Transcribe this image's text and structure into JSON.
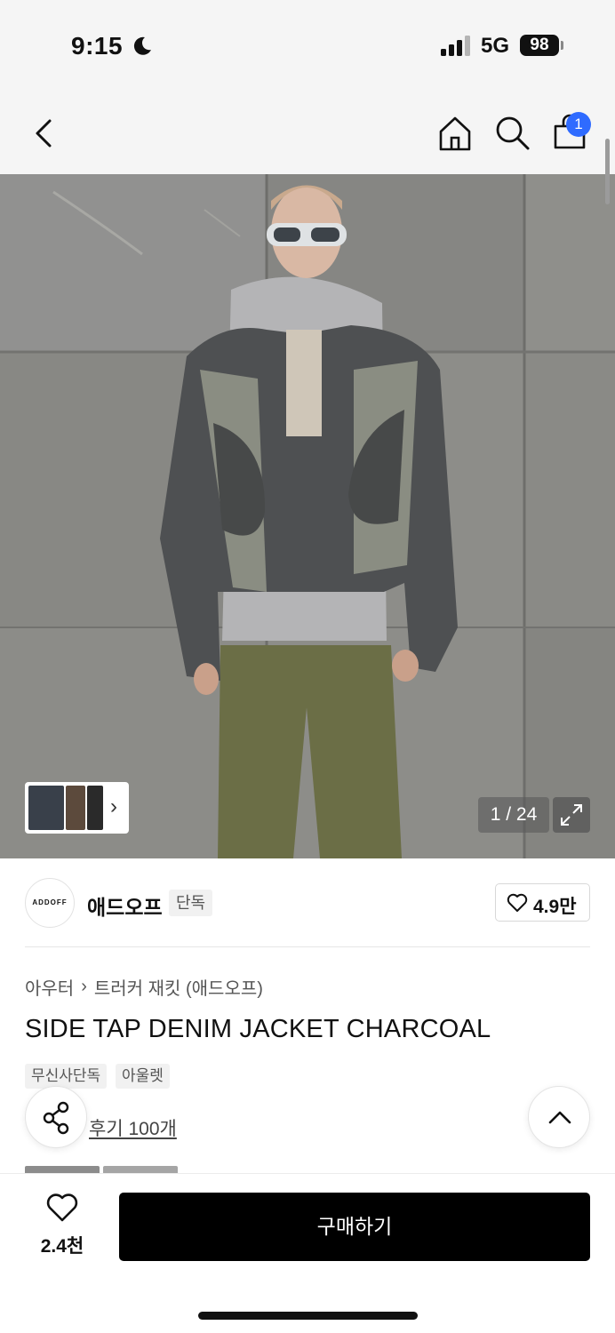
{
  "status_bar": {
    "time": "9:15",
    "network": "5G",
    "battery": "98"
  },
  "nav": {
    "cart_count": "1"
  },
  "gallery": {
    "counter": "1 / 24"
  },
  "brand": {
    "logo_text": "ADDOFF",
    "name": "애드오프",
    "badge": "단독",
    "likes": "4.9만"
  },
  "product": {
    "breadcrumb": [
      "아우터",
      "트러커 재킷 (애드오프)"
    ],
    "title": "SIDE TAP DENIM JACKET CHARCOAL",
    "tags": [
      "무신사단독",
      "아울렛"
    ],
    "review_link": "후기 100개"
  },
  "bottom_bar": {
    "likes": "2.4천",
    "buy_label": "구매하기"
  }
}
